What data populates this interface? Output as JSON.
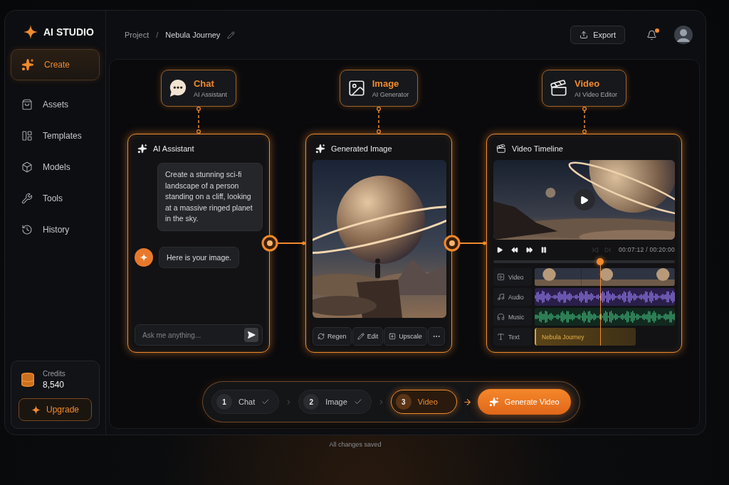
{
  "sidebar": {
    "logo": "AI STUDIO",
    "items": [
      {
        "label": "Create",
        "selected": true
      },
      {
        "label": "Assets",
        "selected": false
      },
      {
        "label": "Templates",
        "selected": false
      },
      {
        "label": "Models",
        "selected": false
      },
      {
        "label": "Tools",
        "selected": false
      },
      {
        "label": "History",
        "selected": false
      }
    ],
    "credits": {
      "label": "Credits",
      "value": "8,540"
    },
    "upgrade_button": "Upgrade"
  },
  "topbar": {
    "breadcrumb": [
      "Project",
      "Nebula Journey"
    ],
    "separator": "/",
    "export_button": "Export",
    "notifications": {
      "unread": true
    }
  },
  "nodes": [
    {
      "title": "Chat",
      "subtitle": "AI Assistant"
    },
    {
      "title": "Image",
      "subtitle": "AI Generator"
    },
    {
      "title": "Video",
      "subtitle": "AI Video Editor"
    }
  ],
  "chat_panel": {
    "title": "AI Assistant",
    "messages": [
      {
        "kind": "user",
        "text": "Create a stunning sci-fi landscape of a person standing on a cliff, looking at a massive ringed planet in the sky."
      },
      {
        "kind": "assistant",
        "text": "Here is your image."
      }
    ],
    "input": {
      "placeholder": "Ask me anything..."
    }
  },
  "image_panel": {
    "title": "Generated Image",
    "actions": [
      "Regen",
      "Edit",
      "Upscale"
    ]
  },
  "video_panel": {
    "title": "Video Timeline",
    "time": "00:07:12 / 00:20:00",
    "playhead": {
      "level": 0.59
    },
    "tracks": [
      {
        "kind": "video",
        "label": "Video"
      },
      {
        "kind": "audio",
        "label": "Audio"
      },
      {
        "kind": "music",
        "label": "Music"
      },
      {
        "kind": "text",
        "label": "Text",
        "clip": "Nebula Journey"
      }
    ]
  },
  "steps": [
    {
      "number": "1",
      "label": "Chat",
      "done": true,
      "selected": false
    },
    {
      "number": "2",
      "label": "Image",
      "done": true,
      "selected": false
    },
    {
      "number": "3",
      "label": "Video",
      "done": false,
      "selected": true
    }
  ],
  "generate_button": "Generate Video",
  "status": "All changes saved"
}
